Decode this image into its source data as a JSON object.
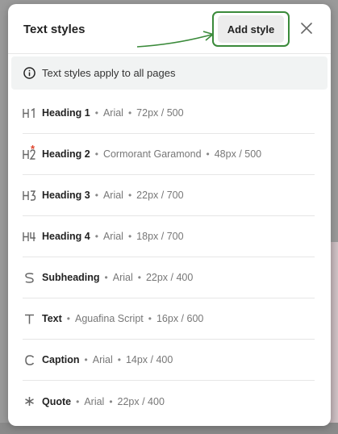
{
  "dialog": {
    "title": "Text styles",
    "add_button": "Add style",
    "close_icon": "close-icon",
    "info_text": "Text styles apply to all pages"
  },
  "styles": [
    {
      "name": "Heading 1",
      "font": "Arial",
      "size": "72px / 500",
      "icon": "h1-icon"
    },
    {
      "name": "Heading 2",
      "font": "Cormorant Garamond",
      "size": "48px / 500",
      "icon": "h2-icon"
    },
    {
      "name": "Heading 3",
      "font": "Arial",
      "size": "22px / 700",
      "icon": "h3-icon"
    },
    {
      "name": "Heading 4",
      "font": "Arial",
      "size": "18px / 700",
      "icon": "h4-icon"
    },
    {
      "name": "Subheading",
      "font": "Arial",
      "size": "22px / 400",
      "icon": "subheading-icon"
    },
    {
      "name": "Text",
      "font": "Aguafina Script",
      "size": "16px / 600",
      "icon": "text-icon"
    },
    {
      "name": "Caption",
      "font": "Arial",
      "size": "14px / 400",
      "icon": "caption-icon"
    },
    {
      "name": "Quote",
      "font": "Arial",
      "size": "22px / 400",
      "icon": "quote-icon"
    }
  ],
  "colors": {
    "highlight": "#3a8a3a",
    "modified_marker": "#e0452c"
  }
}
